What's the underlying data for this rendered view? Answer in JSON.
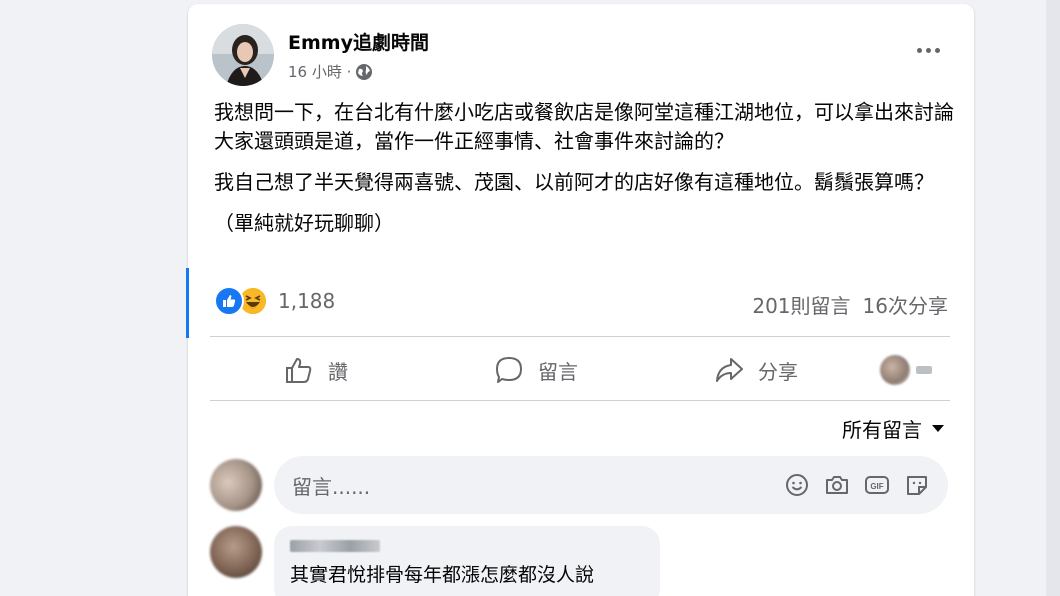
{
  "post": {
    "author": "Emmy追劇時間",
    "time": "16 小時 ·",
    "paragraphs": [
      "我想問一下，在台北有什麼小吃店或餐飲店是像阿堂這種江湖地位，可以拿出來討論大家還頭頭是道，當作一件正經事情、社會事件來討論的？",
      "我自己想了半天覺得兩喜號、茂園、以前阿才的店好像有這種地位。鬍鬚張算嗎？",
      "（單純就好玩聊聊）"
    ],
    "reaction_count": "1,188",
    "comments_count": "201則留言",
    "shares_count": "16次分享"
  },
  "actions": {
    "like": "讚",
    "comment": "留言",
    "share": "分享"
  },
  "sort": {
    "label": "所有留言"
  },
  "composer": {
    "placeholder": "留言......"
  },
  "comment": {
    "text": "其實君悅排骨每年都漲怎麼都沒人說"
  },
  "colors": {
    "accent": "#1877f2",
    "secondary_text": "#65676b",
    "haha": "#f7b928"
  },
  "icons": [
    "more-icon",
    "globe-icon",
    "like-icon",
    "comment-icon",
    "share-icon",
    "emoji-icon",
    "camera-icon",
    "gif-icon",
    "sticker-icon"
  ]
}
